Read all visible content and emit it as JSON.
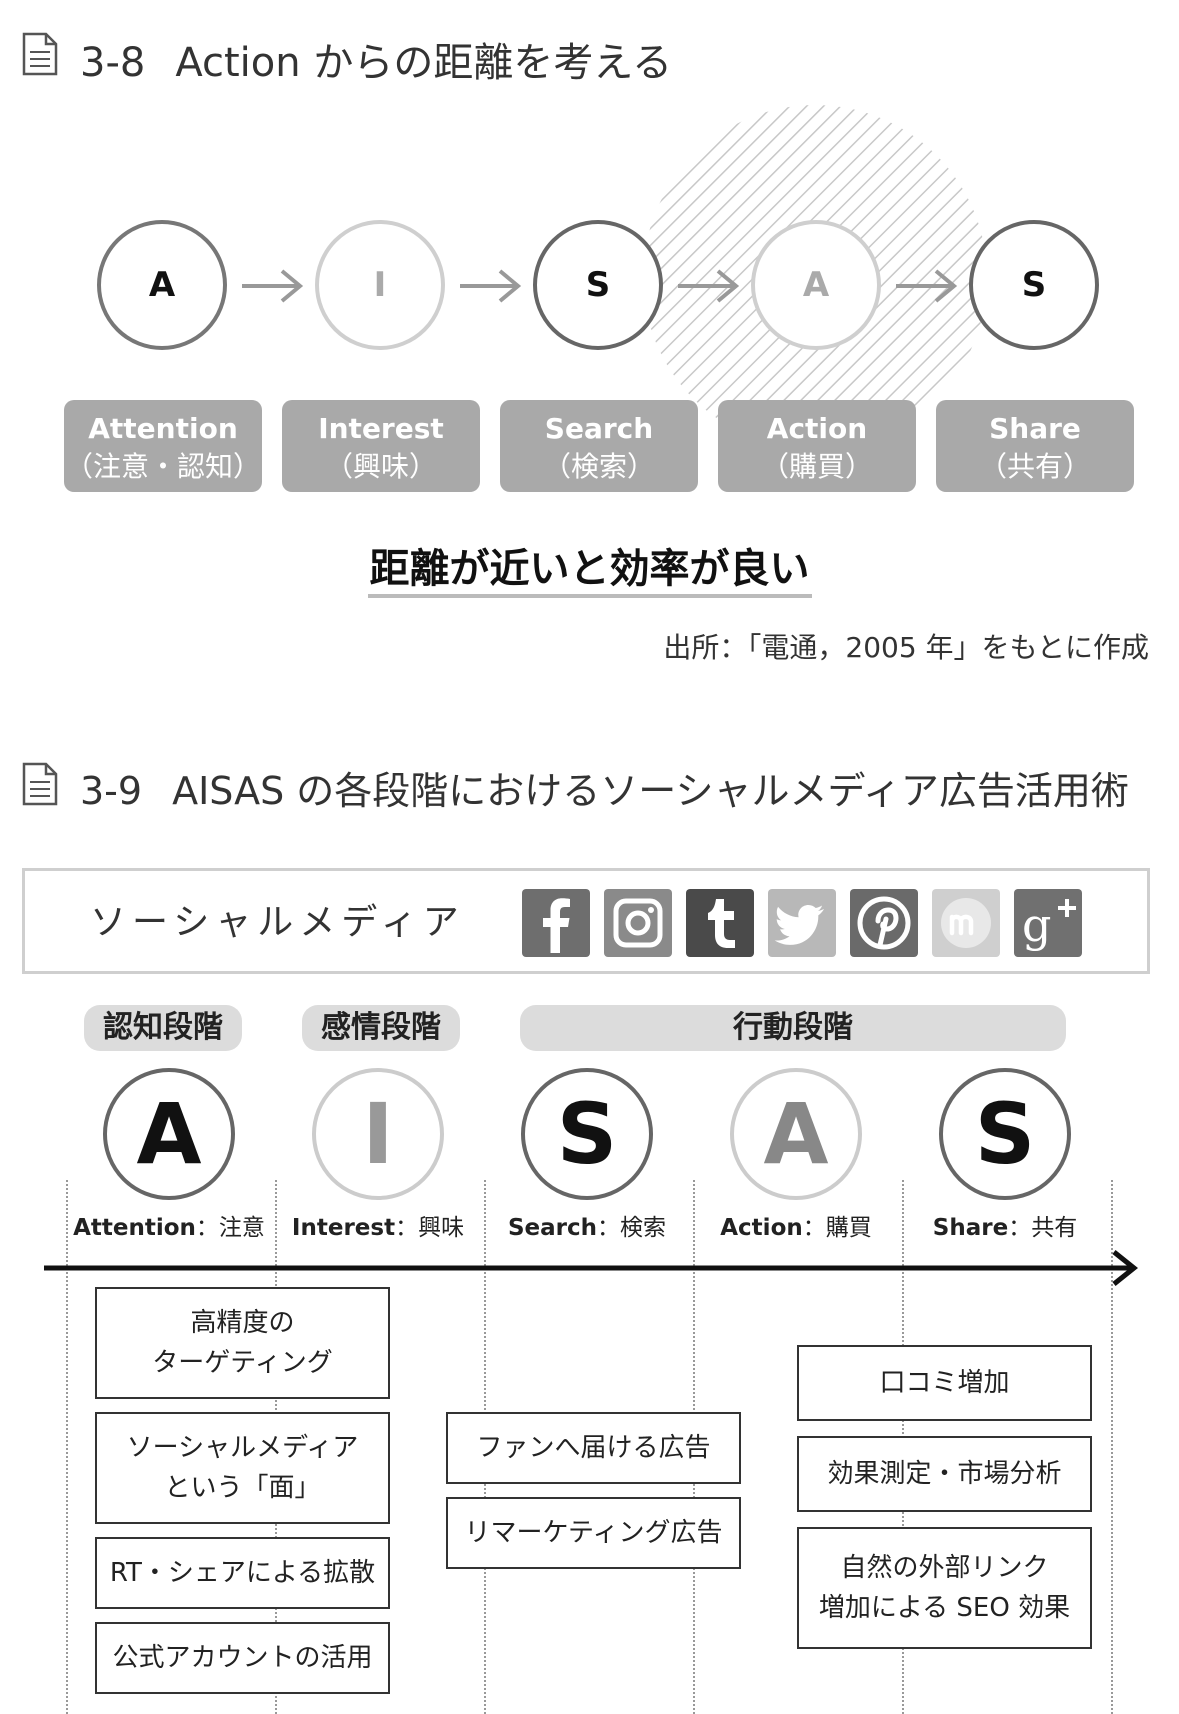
{
  "fig1": {
    "number": "3-8",
    "title": "Action からの距離を考える",
    "steps": [
      {
        "letter": "A",
        "en": "Attention",
        "ja": "（注意・認知）"
      },
      {
        "letter": "I",
        "en": "Interest",
        "ja": "（興味）"
      },
      {
        "letter": "S",
        "en": "Search",
        "ja": "（検索）"
      },
      {
        "letter": "A",
        "en": "Action",
        "ja": "（購買）"
      },
      {
        "letter": "S",
        "en": "Share",
        "ja": "（共有）"
      }
    ],
    "tagline": "距離が近いと効率が良い",
    "source": "出所：「電通，2005 年」をもとに作成"
  },
  "fig2": {
    "number": "3-9",
    "title": "AISAS の各段階におけるソーシャルメディア広告活用術",
    "social_label": "ソーシャルメディア",
    "social_icons": [
      {
        "name": "facebook-icon",
        "glyph": "f",
        "color": "#6e6e6e"
      },
      {
        "name": "instagram-icon",
        "glyph": "",
        "color": "#8a8a8a"
      },
      {
        "name": "tumblr-icon",
        "glyph": "t",
        "color": "#4a4a4a"
      },
      {
        "name": "twitter-icon",
        "glyph": "",
        "color": "#b8b8b8"
      },
      {
        "name": "pinterest-icon",
        "glyph": "p",
        "color": "#6a6a6a"
      },
      {
        "name": "mixi-icon",
        "glyph": "m",
        "color": "#cfcfcf"
      },
      {
        "name": "google-plus-icon",
        "glyph": "g+",
        "color": "#707070"
      }
    ],
    "stages": [
      "認知段階",
      "感情段階",
      "行動段階"
    ],
    "steps": [
      {
        "letter": "A",
        "en": "Attention",
        "ja": "注意"
      },
      {
        "letter": "I",
        "en": "Interest",
        "ja": "興味"
      },
      {
        "letter": "S",
        "en": "Search",
        "ja": "検索"
      },
      {
        "letter": "A",
        "en": "Action",
        "ja": "購買"
      },
      {
        "letter": "S",
        "en": "Share",
        "ja": "共有"
      }
    ],
    "separator": "：",
    "boxes_left": [
      "高精度の\nターゲティング",
      "ソーシャルメディア\nという「面」",
      "RT・シェアによる拡散",
      "公式アカウントの活用"
    ],
    "boxes_mid": [
      "ファンへ届ける広告",
      "リマーケティング広告"
    ],
    "boxes_right": [
      "口コミ増加",
      "効果測定・市場分析",
      "自然の外部リンク\n増加による SEO 効果"
    ]
  }
}
